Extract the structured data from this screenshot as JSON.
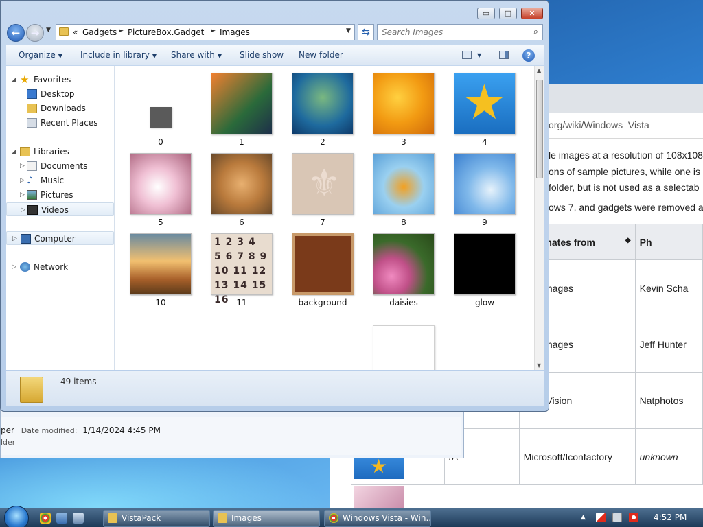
{
  "browser": {
    "url": "org/wiki/Windows_Vista",
    "text_lines": [
      "le images at a resolution of 108x108",
      "ons of sample pictures, while one is",
      "folder, but is not used as a selectab",
      "ows 7, and gadgets were removed a"
    ],
    "table": {
      "headers": [
        "",
        "",
        "Originates from",
        "Ph"
      ],
      "rows": [
        [
          "",
          "",
          "etty Images",
          "Kevin Scha"
        ],
        [
          "",
          "",
          "etty Images",
          "Jeff Hunter"
        ],
        [
          "",
          "",
          "igital Vision",
          "Natphotos"
        ],
        [
          "",
          "/A",
          "Microsoft/Iconfactory",
          "unknown"
        ]
      ]
    }
  },
  "back_window": {
    "name_fragment": "per",
    "date_label": "Date modified:",
    "date_value": "1/14/2024 4:45 PM",
    "type_fragment": "lder"
  },
  "explorer": {
    "caption": {
      "minimize": "▭",
      "maximize": "□",
      "close": "✕"
    },
    "breadcrumb": {
      "overflow": "«",
      "parts": [
        "Gadgets",
        "PictureBox.Gadget",
        "Images"
      ]
    },
    "search_placeholder": "Search Images",
    "toolbar": {
      "organize": "Organize",
      "include": "Include in library",
      "share": "Share with",
      "slideshow": "Slide show",
      "newfolder": "New folder"
    },
    "nav": {
      "favorites": "Favorites",
      "desktop": "Desktop",
      "downloads": "Downloads",
      "recent": "Recent Places",
      "libraries": "Libraries",
      "documents": "Documents",
      "music": "Music",
      "pictures": "Pictures",
      "videos": "Videos",
      "computer": "Computer",
      "network": "Network"
    },
    "files": [
      {
        "name": "0",
        "color": "#5a5a5a"
      },
      {
        "name": "1",
        "color": "#e8602a"
      },
      {
        "name": "2",
        "color": "#1e6a9e"
      },
      {
        "name": "3",
        "color": "#f29a12"
      },
      {
        "name": "4",
        "color": "#1a8ee0"
      },
      {
        "name": "5",
        "color": "#e6a7c0"
      },
      {
        "name": "6",
        "color": "#b97a3c"
      },
      {
        "name": "7",
        "color": "#d9c6b5"
      },
      {
        "name": "8",
        "color": "#7fc0ea"
      },
      {
        "name": "9",
        "color": "#4a90d8"
      },
      {
        "name": "10",
        "color": "#d99a4a"
      },
      {
        "name": "11",
        "color": "#e8dccf"
      },
      {
        "name": "background",
        "color": "#7a3a1a"
      },
      {
        "name": "daisies",
        "color": "#c05088"
      },
      {
        "name": "glow",
        "color": "#000000"
      }
    ],
    "status": {
      "count": "49 items"
    }
  },
  "taskbar": {
    "tasks": [
      "VistaPack",
      "Images",
      "Windows Vista - Win..."
    ],
    "clock": "4:52 PM"
  }
}
